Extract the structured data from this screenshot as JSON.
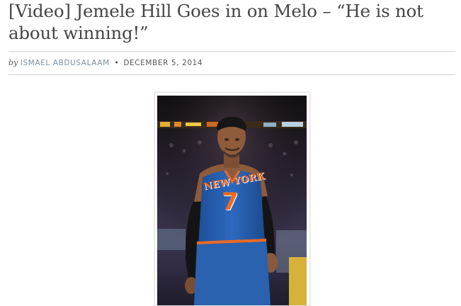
{
  "article": {
    "title": "[Video] Jemele Hill Goes in on Melo – “He is not about winning!”",
    "byline_prefix": "by",
    "author": "ISMAEL ABDUSALAAM",
    "separator": "•",
    "date": "DECEMBER 5, 2014"
  },
  "photo": {
    "jersey_team": "NEW YORK",
    "jersey_number": "7"
  },
  "colors": {
    "jersey_blue": "#2a62b0",
    "jersey_orange": "#ee6a22",
    "author_link": "#7b8fa3",
    "rule": "#cfcfcf"
  }
}
